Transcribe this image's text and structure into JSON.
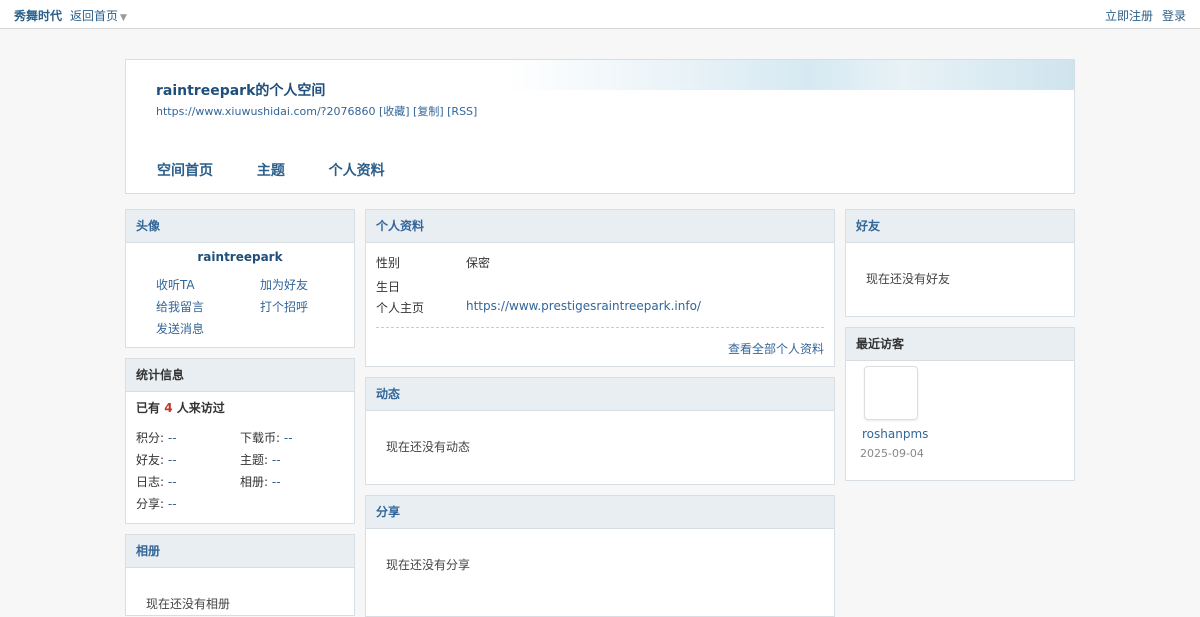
{
  "topbar": {
    "site_name": "秀舞时代",
    "back_home": "返回首页",
    "register": "立即注册",
    "login": "登录"
  },
  "header": {
    "title": "raintreepark的个人空间",
    "url_line": "https://www.xiuwushidai.com/?2076860 [收藏] [复制] [RSS]",
    "nav": [
      "空间首页",
      "主题",
      "个人资料"
    ]
  },
  "avatar_panel": {
    "title": "头像",
    "username": "raintreepark",
    "actions": [
      "收听TA",
      "加为好友",
      "给我留言",
      "打个招呼",
      "发送消息"
    ]
  },
  "stats_panel": {
    "title": "统计信息",
    "visitors_prefix": "已有",
    "visitors_count": "4",
    "visitors_suffix": "人来访过",
    "items": [
      {
        "label": "积分:",
        "value": "--"
      },
      {
        "label": "下载币:",
        "value": "--"
      },
      {
        "label": "好友:",
        "value": "--"
      },
      {
        "label": "主题:",
        "value": "--"
      },
      {
        "label": "日志:",
        "value": "--"
      },
      {
        "label": "相册:",
        "value": "--"
      },
      {
        "label": "分享:",
        "value": "--"
      }
    ]
  },
  "album_panel": {
    "title": "相册",
    "empty": "现在还没有相册"
  },
  "profile_panel": {
    "title": "个人资料",
    "rows": [
      {
        "label": "性别",
        "value": "保密"
      },
      {
        "label": "生日",
        "value": ""
      },
      {
        "label": "个人主页",
        "value": "https://www.prestigesraintreepark.info/"
      }
    ],
    "more": "查看全部个人资料"
  },
  "feed_panel": {
    "title": "动态",
    "empty": "现在还没有动态"
  },
  "share_panel": {
    "title": "分享",
    "empty": "现在还没有分享"
  },
  "friends_panel": {
    "title": "好友",
    "empty": "现在还没有好友"
  },
  "visitors_panel": {
    "title": "最近访客",
    "visitor_name": "roshanpms",
    "visitor_date": "2025-09-04"
  }
}
